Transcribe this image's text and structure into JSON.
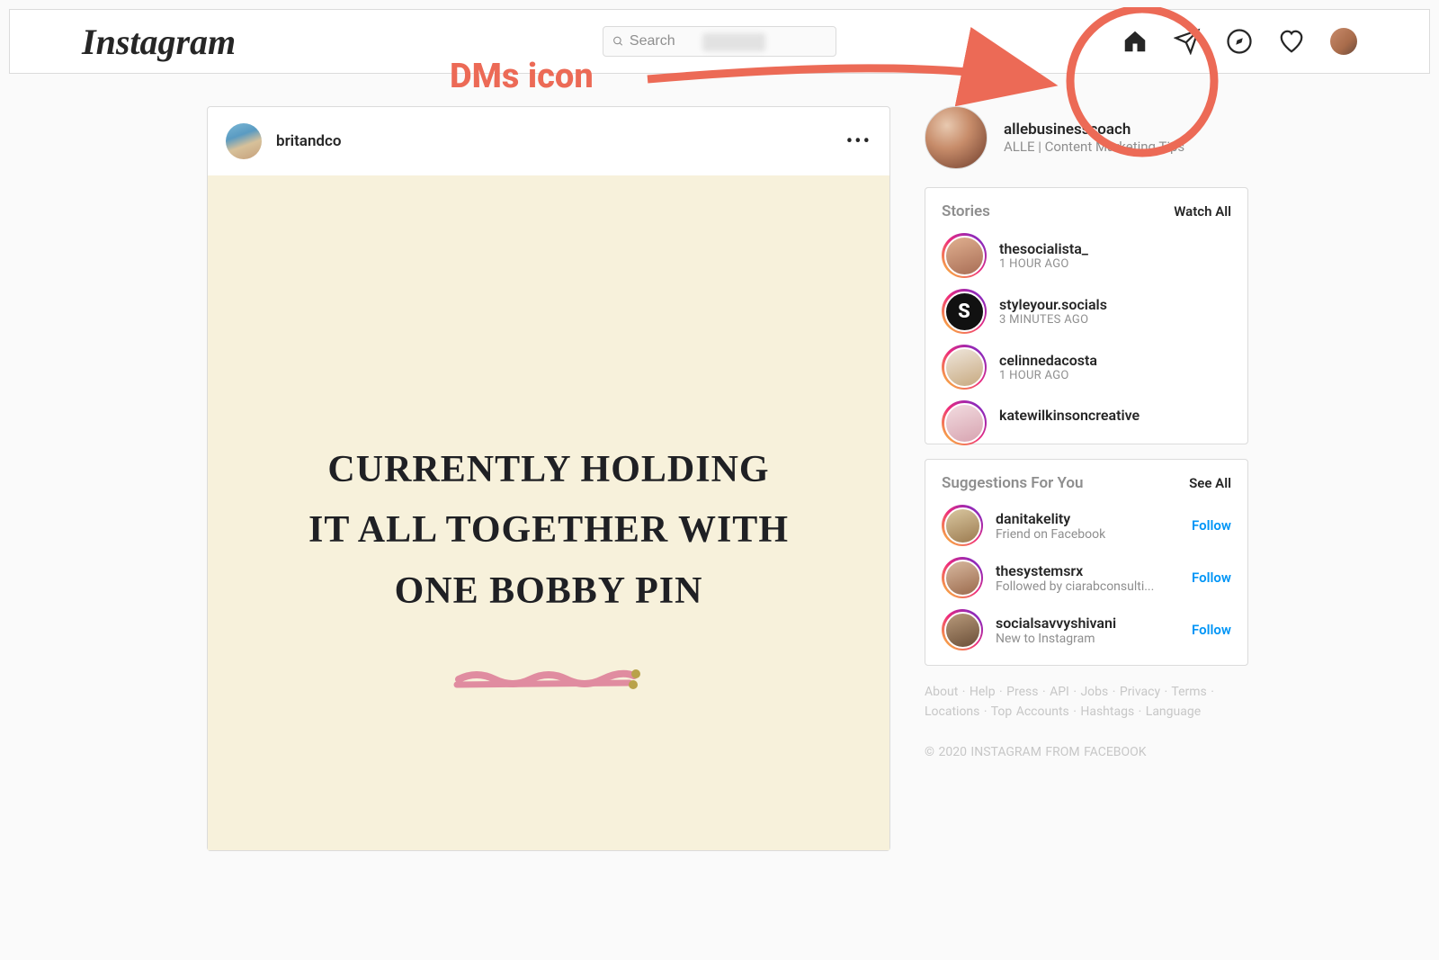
{
  "header": {
    "logo_text": "Instagram",
    "search_placeholder": "Search"
  },
  "annotation": {
    "label": "DMs icon"
  },
  "post": {
    "username": "britandco",
    "image_text": "CURRENTLY HOLDING\nIT ALL TOGETHER WITH\nONE BOBBY PIN"
  },
  "profile": {
    "username": "allebusinesscoach",
    "subtitle": "ALLE | Content Marketing Tips"
  },
  "stories": {
    "title": "Stories",
    "action": "Watch All",
    "items": [
      {
        "user": "thesocialista_",
        "sub": "1 HOUR AGO"
      },
      {
        "user": "styleyour.socials",
        "sub": "3 MINUTES AGO"
      },
      {
        "user": "celinnedacosta",
        "sub": "1 HOUR AGO"
      },
      {
        "user": "katewilkinsoncreative",
        "sub": ""
      }
    ]
  },
  "suggestions": {
    "title": "Suggestions For You",
    "action": "See All",
    "items": [
      {
        "user": "danitakelity",
        "sub": "Friend on Facebook",
        "follow": "Follow"
      },
      {
        "user": "thesystemsrx",
        "sub": "Followed by ciarabconsulti...",
        "follow": "Follow"
      },
      {
        "user": "socialsavvyshivani",
        "sub": "New to Instagram",
        "follow": "Follow"
      }
    ]
  },
  "footer": {
    "links": "About · Help · Press · API · Jobs · Privacy · Terms · Locations · Top Accounts · Hashtags · Language",
    "copyright": "© 2020 INSTAGRAM FROM FACEBOOK"
  }
}
